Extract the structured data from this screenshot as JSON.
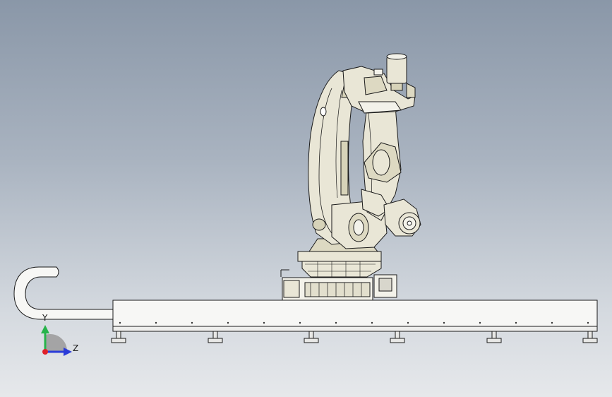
{
  "triad": {
    "y_label": "Y",
    "z_label": "Z",
    "colors": {
      "y": "#27b34a",
      "z": "#2a3bd8",
      "x": "#e0202a"
    }
  },
  "scene": {
    "model": "robot-on-linear-track",
    "colors": {
      "robot_body": "#e9e6d6",
      "robot_shade": "#d7d3b9",
      "outline": "#1b1b1b",
      "track": "#f7f7f5"
    }
  }
}
